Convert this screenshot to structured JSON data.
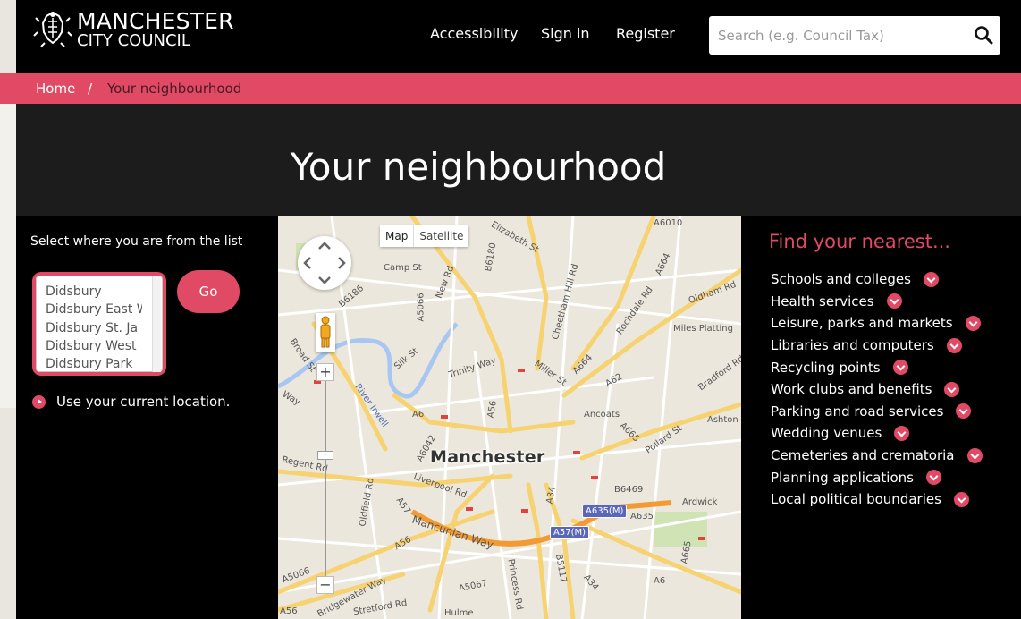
{
  "header": {
    "logo_title": "MANCHESTER",
    "logo_subtitle": "CITY COUNCIL",
    "nav": [
      "Accessibility",
      "Sign in",
      "Register"
    ],
    "search_placeholder": "Search (e.g. Council Tax)"
  },
  "breadcrumb": {
    "home": "Home",
    "separator": "/",
    "current": "Your neighbourhood"
  },
  "page_title": "Your neighbourhood",
  "left_panel": {
    "select_label": "Select where you are from the list",
    "areas": [
      "Didsbury",
      "Didsbury East W",
      "Didsbury St. Ja",
      "Didsbury West",
      "Didsbury Park"
    ],
    "go_label": "Go",
    "use_location": "Use your current location."
  },
  "map": {
    "type_buttons": [
      "Map",
      "Satellite"
    ],
    "city_label": "Manchester",
    "zoom_in": "+",
    "zoom_out": "−",
    "labels": {
      "camp_st": "Camp St",
      "new_rd": "New Rd",
      "b6180": "B6180",
      "elizabeth_st": "Elizabeth St",
      "a6010": "A6010",
      "a664": "A664",
      "oldham_rd": "Oldham Rd",
      "a5066_top": "A5066",
      "b6186": "B6186",
      "cheetham_hill_rd": "Cheetham Hill Rd",
      "rochdale_rd": "Rochdale Rd",
      "miles_platting": "Miles Platting",
      "broad_st": "Broad St",
      "silk_st": "Silk St",
      "trinity_way": "Trinity Way",
      "miller_st": "Miller St",
      "a664_mid": "A664",
      "a62": "A62",
      "bradford_rd": "Bradford Rd",
      "way": "Way",
      "river_irwell": "River Irwell",
      "a6": "A6",
      "a56": "A56",
      "ancoats": "Ancoats",
      "ashton": "Ashton",
      "a665": "A665",
      "pollard_st": "Pollard St",
      "regent_rd": "Regent Rd",
      "a6042": "A6042",
      "liverpool_rd": "Liverpool Rd",
      "b6469": "B6469",
      "ardwick": "Ardwick",
      "a57": "A57",
      "a34": "A34",
      "a635m": "A635(M)",
      "a635": "A635",
      "a57m": "A57(M)",
      "oldfield_rd": "Oldfield Rd",
      "mancunian_way": "Mancunian Way",
      "a56_low": "A56",
      "b5117": "B5117",
      "a665_low": "A665",
      "a5066": "A5066",
      "bridgewater_way": "Bridgewater Way",
      "a5067": "A5067",
      "princess_rd": "Princess Rd",
      "a34_low": "A34",
      "a6_low": "A6",
      "a56_bottom": "A56",
      "stretford_rd": "Stretford Rd",
      "hulme": "Hulme"
    }
  },
  "right_panel": {
    "title": "Find your nearest...",
    "items": [
      "Schools and colleges",
      "Health services",
      "Leisure, parks and markets",
      "Libraries and computers",
      "Recycling points",
      "Work clubs and benefits",
      "Parking and road services",
      "Wedding venues",
      "Cemeteries and crematoria",
      "Planning applications",
      "Local political boundaries"
    ]
  },
  "colors": {
    "accent": "#e04a64",
    "header_bg": "#000000",
    "title_band_bg": "#1c1c1c"
  }
}
